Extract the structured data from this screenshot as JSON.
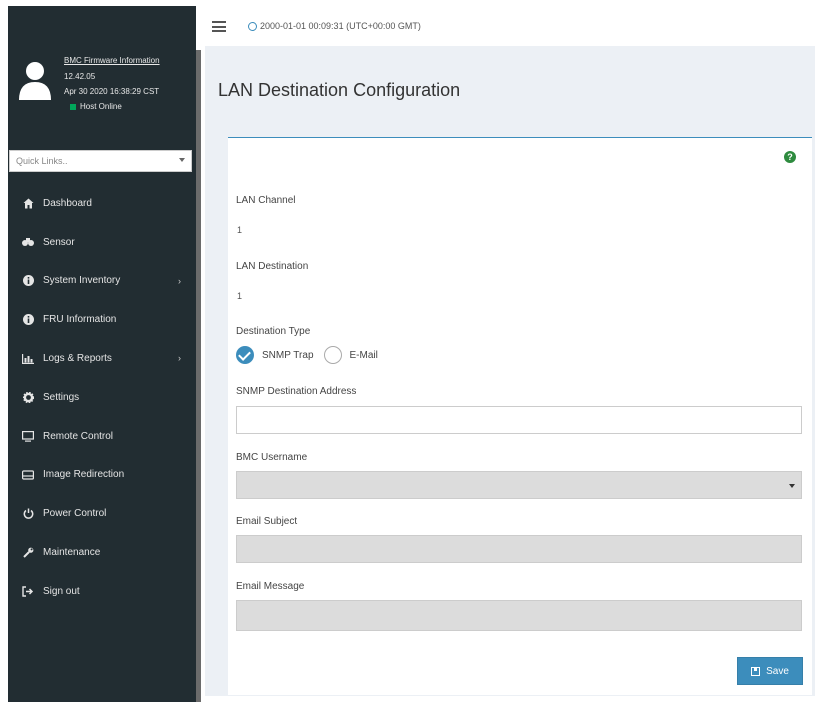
{
  "header": {
    "clock_text": "2000-01-01 00:09:31 (UTC+00:00 GMT)"
  },
  "sidebar": {
    "firmware_link": "BMC Firmware Information",
    "firmware_version": "12.42.05",
    "firmware_date": "Apr 30 2020 16:38:29 CST",
    "host_status": "Host Online",
    "quick_links_placeholder": "Quick Links..",
    "items": [
      {
        "label": "Dashboard",
        "icon": "dashboard-icon"
      },
      {
        "label": "Sensor",
        "icon": "sensor-icon"
      },
      {
        "label": "System Inventory",
        "icon": "info-icon",
        "has_submenu": true
      },
      {
        "label": "FRU Information",
        "icon": "info-icon"
      },
      {
        "label": "Logs & Reports",
        "icon": "chart-icon",
        "has_submenu": true
      },
      {
        "label": "Settings",
        "icon": "gear-icon"
      },
      {
        "label": "Remote Control",
        "icon": "monitor-icon"
      },
      {
        "label": "Image Redirection",
        "icon": "disk-icon"
      },
      {
        "label": "Power Control",
        "icon": "power-icon"
      },
      {
        "label": "Maintenance",
        "icon": "wrench-icon"
      },
      {
        "label": "Sign out",
        "icon": "sign-out-icon"
      }
    ]
  },
  "page": {
    "title": "LAN Destination Configuration",
    "lan_channel_label": "LAN Channel",
    "lan_channel_value": "1",
    "lan_destination_label": "LAN Destination",
    "lan_destination_value": "1",
    "destination_type_label": "Destination Type",
    "option_snmp": "SNMP Trap",
    "option_email": "E-Mail",
    "selected_type": "SNMP Trap",
    "snmp_address_label": "SNMP Destination Address",
    "snmp_address_value": "",
    "bmc_username_label": "BMC Username",
    "bmc_username_value": "",
    "email_subject_label": "Email Subject",
    "email_subject_value": "",
    "email_message_label": "Email Message",
    "email_message_value": "",
    "save_label": "Save"
  },
  "colors": {
    "sidebar_bg": "#222d32",
    "accent": "#3c8dbc",
    "status_online": "#00a65a",
    "help": "#2e8b3f"
  }
}
